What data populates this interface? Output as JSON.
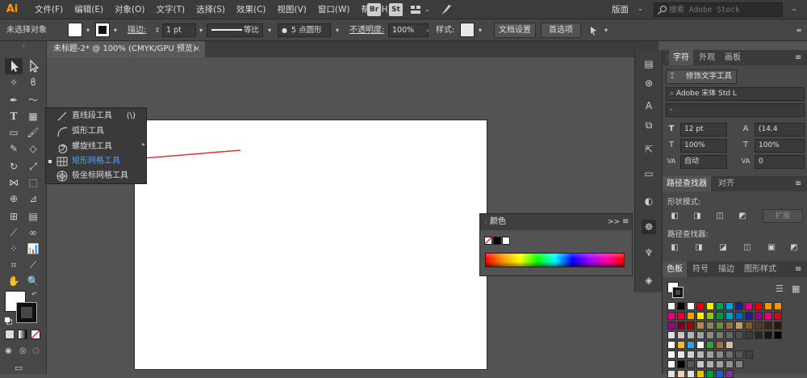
{
  "app": {
    "logo": "Ai"
  },
  "menu": [
    "文件(F)",
    "编辑(E)",
    "对象(O)",
    "文字(T)",
    "选择(S)",
    "效果(C)",
    "视图(V)",
    "窗口(W)",
    "帮助(H)"
  ],
  "menu_buttons": {
    "bridge": "Br",
    "stock": "St"
  },
  "workspace": "版面",
  "search": {
    "placeholder": "搜索 Adobe Stock"
  },
  "control_bar": {
    "selection_label": "未选择对象",
    "stroke_label": "描边:",
    "stroke_value": "1 pt",
    "stroke_profile": "等比",
    "brush": "5 点圆形",
    "opacity_label": "不透明度:",
    "opacity_value": "100%",
    "style_label": "样式:",
    "doc_setup": "文档设置",
    "preferences": "首选项"
  },
  "document": {
    "tab_title": "未标题-2* @ 100% (CMYK/GPU 预览)",
    "close": "×"
  },
  "flyout": {
    "items": [
      {
        "label": "直线段工具",
        "shortcut": "(\\)",
        "icon": "line-segment-icon"
      },
      {
        "label": "弧形工具",
        "shortcut": "",
        "icon": "arc-icon"
      },
      {
        "label": "螺旋线工具",
        "shortcut": "",
        "icon": "spiral-icon"
      },
      {
        "label": "矩形网格工具",
        "shortcut": "",
        "icon": "rectangular-grid-icon"
      },
      {
        "label": "极坐标网格工具",
        "shortcut": "",
        "icon": "polar-grid-icon"
      }
    ]
  },
  "color_panel": {
    "title": "颜色",
    "menu": ">>"
  },
  "right_panel": {
    "char_tabs": [
      "字符",
      "外观",
      "画板"
    ],
    "touch_type": "修饰文字工具",
    "font_family": "Adobe 宋体 Std L",
    "font_style": "-",
    "font_size": "12 pt",
    "leading": "(14.4",
    "h_scale": "100%",
    "v_scale": "100%",
    "kerning": "自动",
    "tracking": "0",
    "pathfinder_tabs": [
      "路径查找器",
      "对齐"
    ],
    "shape_modes": "形状模式:",
    "expand": "扩展",
    "pathfinders": "路径查找器:",
    "swatch_tabs": [
      "色板",
      "符号",
      "描边",
      "图形样式"
    ]
  },
  "colors": {
    "accent_orange": "#ff9a00",
    "active_item_blue": "#4aa3ff",
    "arrow_red": "#e8373b"
  }
}
